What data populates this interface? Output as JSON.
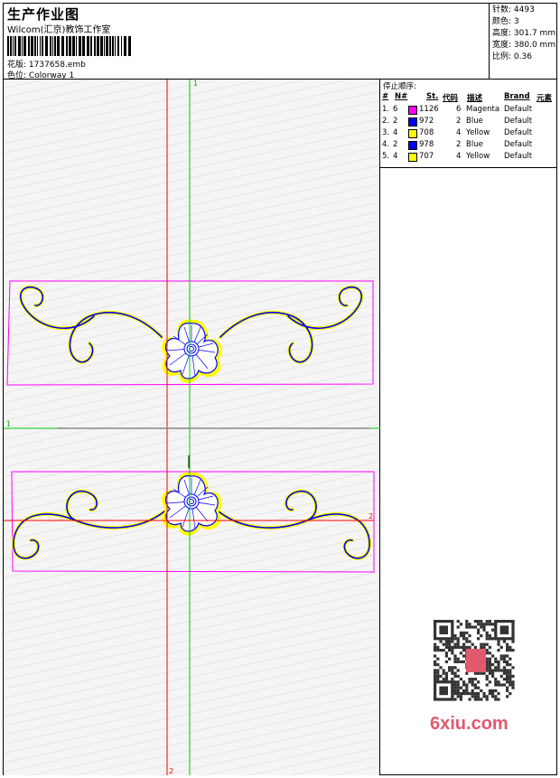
{
  "header": {
    "title": "生产作业图",
    "company": "Wilcom(汇京)教饰工作室",
    "pattern_label": "花版:",
    "pattern_value": "1737658.emb",
    "color_label": "色位:",
    "color_value": "Colorway 1"
  },
  "stats": {
    "stitches_label": "针数:",
    "stitches_value": "4493",
    "colors_label": "颜色:",
    "colors_value": "3",
    "height_label": "高度:",
    "height_value": "301.7 mm",
    "width_label": "宽度:",
    "width_value": "380.0 mm",
    "scale_label": "比例:",
    "scale_value": "0.36"
  },
  "stop_sequence": {
    "title": "停止顺序:",
    "headers": [
      "#",
      "N#",
      "St.",
      "代码",
      "描述",
      "Brand",
      "元素"
    ],
    "rows": [
      {
        "index": "1.",
        "needle": "6",
        "stitches": "1126",
        "code": "6",
        "desc": "Magenta",
        "brand": "Default",
        "color": "#ff00ff"
      },
      {
        "index": "2.",
        "needle": "2",
        "stitches": "972",
        "code": "2",
        "desc": "Blue",
        "brand": "Default",
        "color": "#0000ff"
      },
      {
        "index": "3.",
        "needle": "4",
        "stitches": "708",
        "code": "4",
        "desc": "Yellow",
        "brand": "Default",
        "color": "#ffff00"
      },
      {
        "index": "4.",
        "needle": "2",
        "stitches": "978",
        "code": "2",
        "desc": "Blue",
        "brand": "Default",
        "color": "#0000ff"
      },
      {
        "index": "5.",
        "needle": "4",
        "stitches": "707",
        "code": "4",
        "desc": "Yellow",
        "brand": "Default",
        "color": "#ffff00"
      }
    ]
  },
  "guides": {
    "top_label": "1",
    "left_label": "1",
    "right_label": "2",
    "bottom_label": "2"
  },
  "watermark": {
    "qr_seal_text": "6xiu",
    "logo_text": "6xiu.com"
  },
  "colors": {
    "magenta": "#ff00ff",
    "blue": "#0000ff",
    "yellow": "#ffff00",
    "guide_red": "#ff0000",
    "guide_green": "#00cc00"
  }
}
